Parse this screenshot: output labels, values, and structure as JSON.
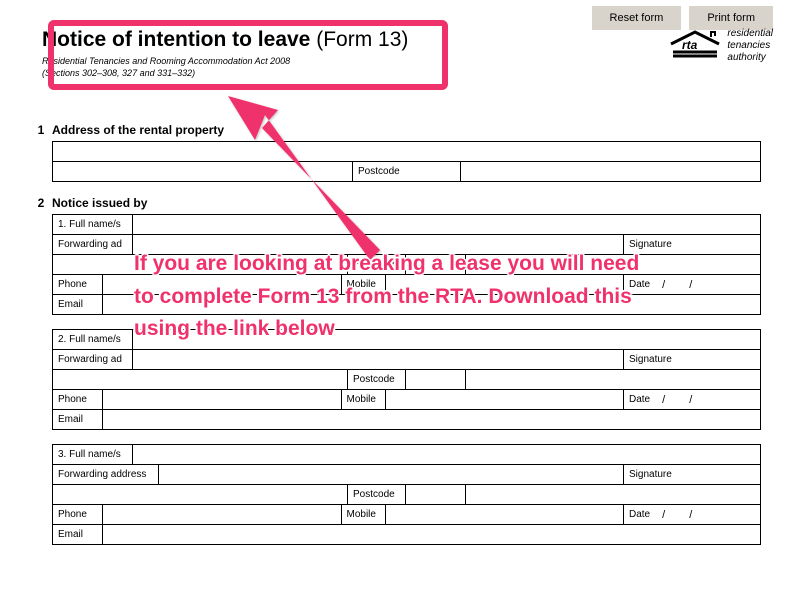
{
  "topbar": {
    "reset": "Reset form",
    "print": "Print form"
  },
  "title_bold": "Notice of intention to leave",
  "title_light": "(Form 13)",
  "subtitle_l1": "Residential Tenancies and Rooming Accommodation Act 2008",
  "subtitle_l2": "(Sections 302–308, 327 and 331–332)",
  "logo": {
    "abbr": "rta",
    "l1": "residential",
    "l2": "tenancies",
    "l3": "authority"
  },
  "s1": {
    "num": "1",
    "label": "Address of the rental property",
    "postcode_label": "Postcode"
  },
  "s2": {
    "num": "2",
    "label": "Notice issued by"
  },
  "labels": {
    "fullname1": "1. Full name/s",
    "fullname2": "2. Full name/s",
    "fullname3": "3. Full name/s",
    "fwd": "Forwarding address",
    "fwd_short": "Forwarding ad",
    "phone": "Phone",
    "mobile": "Mobile",
    "email": "Email",
    "signature": "Signature",
    "postcode": "Postcode",
    "date": "Date",
    "slash": "/"
  },
  "annotation": "If you are looking at breaking a lease you will need to complete Form 13 from the RTA. Download this using the link below"
}
